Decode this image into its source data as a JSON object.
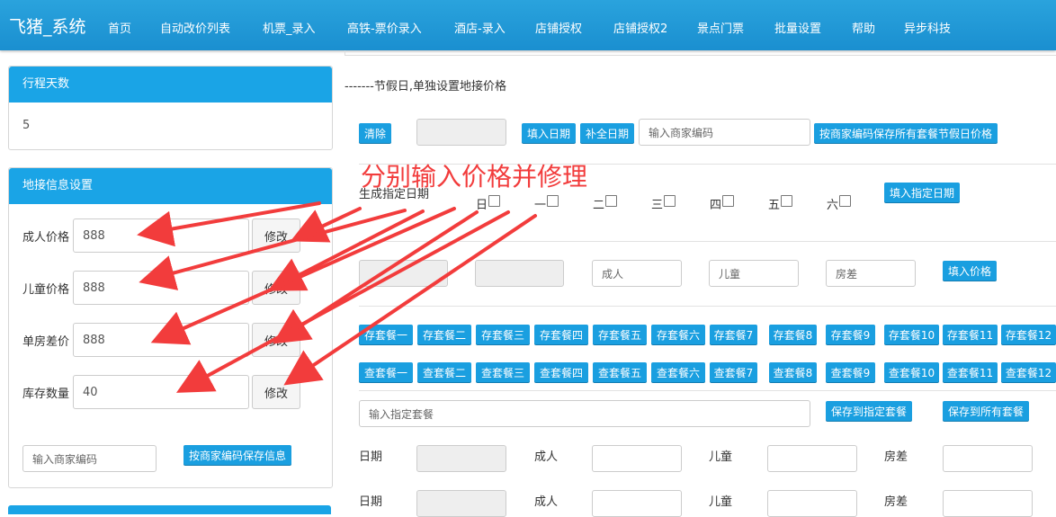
{
  "app": {
    "brand": "飞猪_系统"
  },
  "nav": [
    "首页",
    "自动改价列表",
    "机票_录入",
    "高铁-票价录入",
    "酒店-录入",
    "店铺授权",
    "店铺授权2",
    "景点门票",
    "批量设置",
    "帮助",
    "异步科技"
  ],
  "trip_panel": {
    "title": "行程天数",
    "value": "5"
  },
  "ground_panel": {
    "title": "地接信息设置",
    "fields": [
      {
        "label": "成人价格",
        "value": "888",
        "button": "修改"
      },
      {
        "label": "儿童价格",
        "value": "888",
        "button": "修改"
      },
      {
        "label": "单房差价",
        "value": "888",
        "button": "修改"
      },
      {
        "label": "库存数量",
        "value": "40",
        "button": "修改"
      }
    ],
    "merchant_placeholder": "输入商家编码",
    "save_button": "按商家编码保存信息"
  },
  "holiday": {
    "title": "-------节假日,单独设置地接价格",
    "clear": "清除",
    "fill_date": "填入日期",
    "complete_date": "补全日期",
    "merchant_placeholder": "输入商家编码",
    "save_holiday": "按商家编码保存所有套餐节假日价格"
  },
  "generate": {
    "label": "生成指定日期",
    "weekdays": [
      "日",
      "一",
      "二",
      "三",
      "四",
      "五",
      "六"
    ],
    "fill_button": "填入指定日期"
  },
  "price_row": {
    "adult_ph": "成人",
    "child_ph": "儿童",
    "room_ph": "房差",
    "fill_button": "填入价格"
  },
  "save_packages": [
    "存套餐一",
    "存套餐二",
    "存套餐三",
    "存套餐四",
    "存套餐五",
    "存套餐六",
    "存套餐7",
    "存套餐8",
    "存套餐9",
    "存套餐10",
    "存套餐11",
    "存套餐12"
  ],
  "view_packages": [
    "查套餐一",
    "查套餐二",
    "查套餐三",
    "查套餐四",
    "查套餐五",
    "查套餐六",
    "查套餐7",
    "查套餐8",
    "查套餐9",
    "查套餐10",
    "查套餐11",
    "查套餐12"
  ],
  "package": {
    "placeholder": "输入指定套餐",
    "save_specified": "保存到指定套餐",
    "save_all": "保存到所有套餐"
  },
  "detail_labels": {
    "date": "日期",
    "adult": "成人",
    "child": "儿童",
    "room": "房差"
  },
  "annotation": {
    "text": "分别输入价格并修理",
    "color": "#f23c3c"
  },
  "colors": {
    "nav_bg": "#1a9cdb",
    "button": "#1a9fe0",
    "panel_head": "#1aa4e6"
  }
}
